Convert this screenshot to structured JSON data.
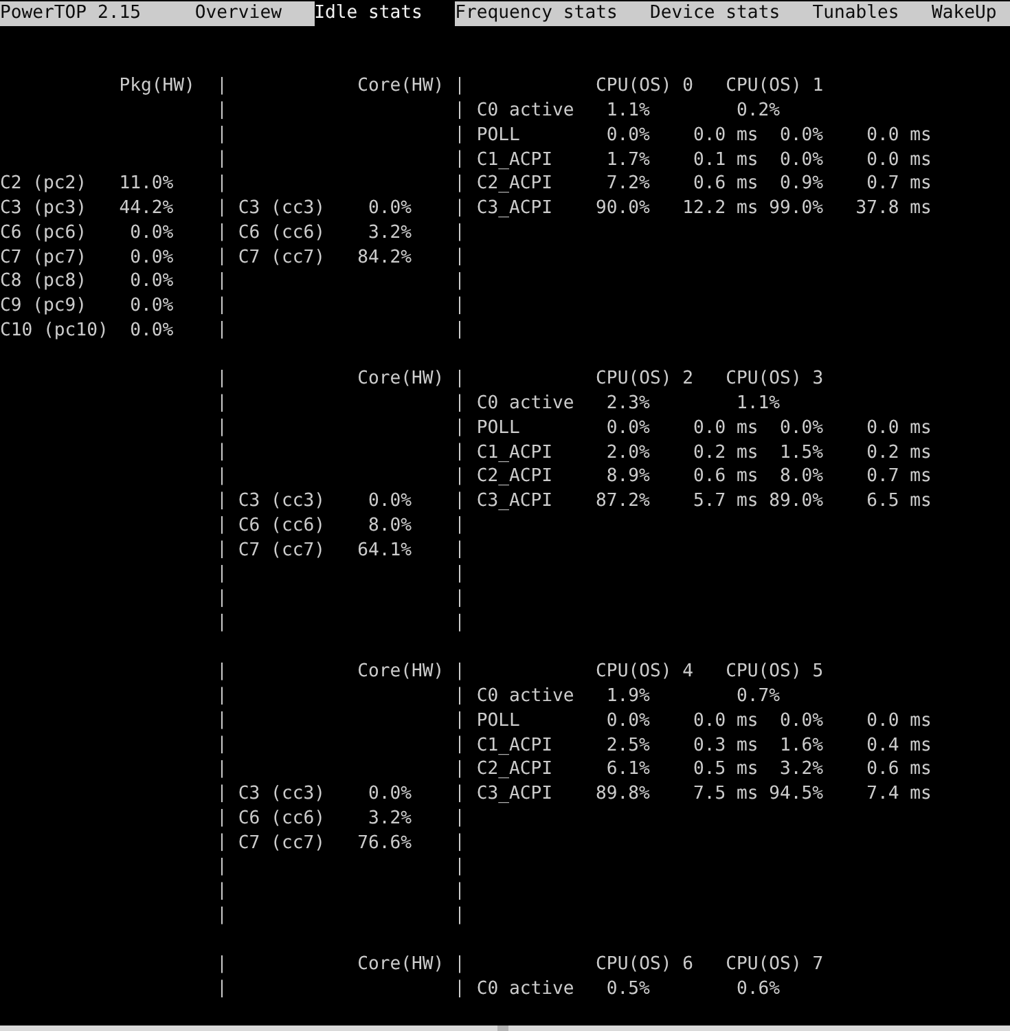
{
  "title": "PowerTOP 2.15",
  "tabs": [
    {
      "label": "Overview",
      "selected": false
    },
    {
      "label": "Idle stats",
      "selected": true
    },
    {
      "label": "Frequency stats",
      "selected": false
    },
    {
      "label": "Device stats",
      "selected": false
    },
    {
      "label": "Tunables",
      "selected": false
    },
    {
      "label": "WakeUp",
      "selected": false
    }
  ],
  "blocks": [
    {
      "headers": {
        "package": "Pkg(HW)",
        "core": "Core(HW)",
        "cpus": [
          "CPU(OS) 0",
          "CPU(OS) 1"
        ]
      },
      "rows": [
        {
          "cpu": {
            "kind": "active",
            "state": "C0 active",
            "usage": [
              "1.1%",
              "0.2%"
            ]
          }
        },
        {
          "cpu": {
            "kind": "idle",
            "state": "POLL",
            "usage": [
              {
                "percent": "0.0%",
                "time": "0.0 ms"
              },
              {
                "percent": "0.0%",
                "time": "0.0 ms"
              }
            ]
          }
        },
        {
          "cpu": {
            "kind": "idle",
            "state": "C1_ACPI",
            "usage": [
              {
                "percent": "1.7%",
                "time": "0.1 ms"
              },
              {
                "percent": "0.0%",
                "time": "0.0 ms"
              }
            ]
          }
        },
        {
          "package": {
            "state": "C2 (pc2)",
            "value": "11.0%"
          },
          "cpu": {
            "kind": "idle",
            "state": "C2_ACPI",
            "usage": [
              {
                "percent": "7.2%",
                "time": "0.6 ms"
              },
              {
                "percent": "0.9%",
                "time": "0.7 ms"
              }
            ]
          }
        },
        {
          "package": {
            "state": "C3 (pc3)",
            "value": "44.2%"
          },
          "core": {
            "state": "C3 (cc3)",
            "value": "0.0%"
          },
          "cpu": {
            "kind": "idle",
            "state": "C3_ACPI",
            "usage": [
              {
                "percent": "90.0%",
                "time": "12.2 ms"
              },
              {
                "percent": "99.0%",
                "time": "37.8 ms"
              }
            ]
          }
        },
        {
          "package": {
            "state": "C6 (pc6)",
            "value": "0.0%"
          },
          "core": {
            "state": "C6 (cc6)",
            "value": "3.2%"
          }
        },
        {
          "package": {
            "state": "C7 (pc7)",
            "value": "0.0%"
          },
          "core": {
            "state": "C7 (cc7)",
            "value": "84.2%"
          }
        },
        {
          "package": {
            "state": "C8 (pc8)",
            "value": "0.0%"
          }
        },
        {
          "package": {
            "state": "C9 (pc9)",
            "value": "0.0%"
          }
        },
        {
          "package": {
            "state": "C10 (pc10)",
            "value": "0.0%"
          }
        }
      ]
    },
    {
      "headers": {
        "core": "Core(HW)",
        "cpus": [
          "CPU(OS) 2",
          "CPU(OS) 3"
        ]
      },
      "rows": [
        {
          "cpu": {
            "kind": "active",
            "state": "C0 active",
            "usage": [
              "2.3%",
              "1.1%"
            ]
          }
        },
        {
          "cpu": {
            "kind": "idle",
            "state": "POLL",
            "usage": [
              {
                "percent": "0.0%",
                "time": "0.0 ms"
              },
              {
                "percent": "0.0%",
                "time": "0.0 ms"
              }
            ]
          }
        },
        {
          "cpu": {
            "kind": "idle",
            "state": "C1_ACPI",
            "usage": [
              {
                "percent": "2.0%",
                "time": "0.2 ms"
              },
              {
                "percent": "1.5%",
                "time": "0.2 ms"
              }
            ]
          }
        },
        {
          "cpu": {
            "kind": "idle",
            "state": "C2_ACPI",
            "usage": [
              {
                "percent": "8.9%",
                "time": "0.6 ms"
              },
              {
                "percent": "8.0%",
                "time": "0.7 ms"
              }
            ]
          }
        },
        {
          "core": {
            "state": "C3 (cc3)",
            "value": "0.0%"
          },
          "cpu": {
            "kind": "idle",
            "state": "C3_ACPI",
            "usage": [
              {
                "percent": "87.2%",
                "time": "5.7 ms"
              },
              {
                "percent": "89.0%",
                "time": "6.5 ms"
              }
            ]
          }
        },
        {
          "core": {
            "state": "C6 (cc6)",
            "value": "8.0%"
          }
        },
        {
          "core": {
            "state": "C7 (cc7)",
            "value": "64.1%"
          }
        }
      ]
    },
    {
      "headers": {
        "core": "Core(HW)",
        "cpus": [
          "CPU(OS) 4",
          "CPU(OS) 5"
        ]
      },
      "rows": [
        {
          "cpu": {
            "kind": "active",
            "state": "C0 active",
            "usage": [
              "1.9%",
              "0.7%"
            ]
          }
        },
        {
          "cpu": {
            "kind": "idle",
            "state": "POLL",
            "usage": [
              {
                "percent": "0.0%",
                "time": "0.0 ms"
              },
              {
                "percent": "0.0%",
                "time": "0.0 ms"
              }
            ]
          }
        },
        {
          "cpu": {
            "kind": "idle",
            "state": "C1_ACPI",
            "usage": [
              {
                "percent": "2.5%",
                "time": "0.3 ms"
              },
              {
                "percent": "1.6%",
                "time": "0.4 ms"
              }
            ]
          }
        },
        {
          "cpu": {
            "kind": "idle",
            "state": "C2_ACPI",
            "usage": [
              {
                "percent": "6.1%",
                "time": "0.5 ms"
              },
              {
                "percent": "3.2%",
                "time": "0.6 ms"
              }
            ]
          }
        },
        {
          "core": {
            "state": "C3 (cc3)",
            "value": "0.0%"
          },
          "cpu": {
            "kind": "idle",
            "state": "C3_ACPI",
            "usage": [
              {
                "percent": "89.8%",
                "time": "7.5 ms"
              },
              {
                "percent": "94.5%",
                "time": "7.4 ms"
              }
            ]
          }
        },
        {
          "core": {
            "state": "C6 (cc6)",
            "value": "3.2%"
          }
        },
        {
          "core": {
            "state": "C7 (cc7)",
            "value": "76.6%"
          }
        }
      ]
    },
    {
      "headers": {
        "core": "Core(HW)",
        "cpus": [
          "CPU(OS) 6",
          "CPU(OS) 7"
        ]
      },
      "rows": [
        {
          "cpu": {
            "kind": "active",
            "state": "C0 active",
            "usage": [
              "0.5%",
              "0.6%"
            ]
          }
        }
      ]
    }
  ]
}
